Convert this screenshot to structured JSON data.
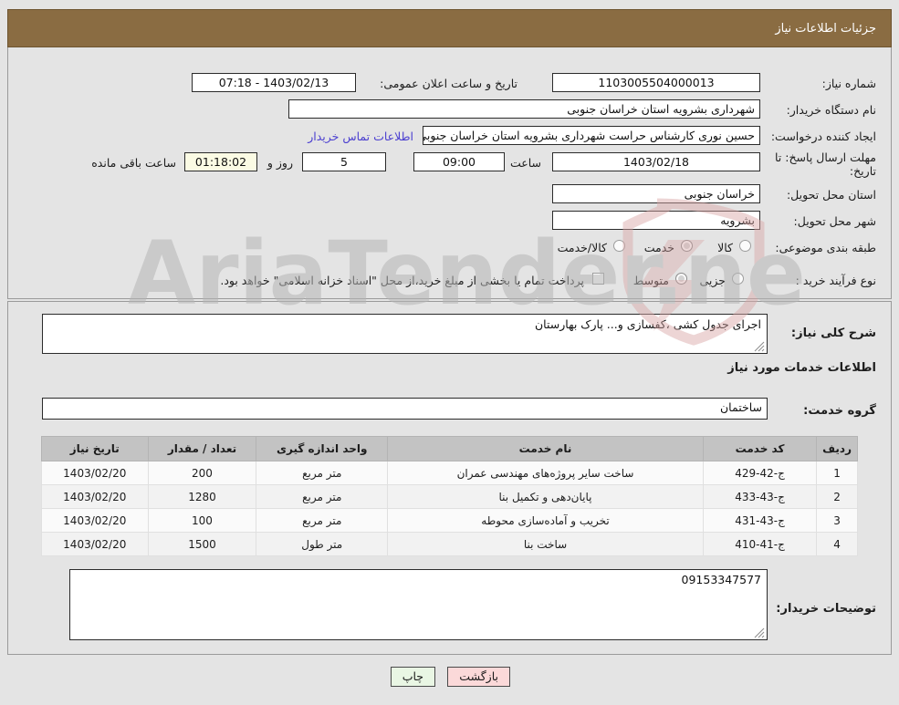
{
  "header": {
    "title": "جزئیات اطلاعات نیاز"
  },
  "top_form": {
    "need_number_label": "شماره نیاز:",
    "need_number_value": "1103005504000013",
    "public_announce_label": "تاریخ و ساعت اعلان عمومی:",
    "public_announce_value": "1403/02/13 - 07:18",
    "buyer_org_label": "نام دستگاه خریدار:",
    "buyer_org_value": "شهرداری بشرویه استان خراسان جنوبی",
    "requester_label": "ایجاد کننده درخواست:",
    "requester_value": "حسین نوری کارشناس حراست شهرداری بشرویه استان خراسان جنوبی",
    "contact_link": "اطلاعات تماس خریدار",
    "deadline_label": "مهلت ارسال پاسخ: تا تاریخ:",
    "deadline_date": "1403/02/18",
    "hour_label": "ساعت",
    "hour_value": "09:00",
    "days_value": "5",
    "days_suffix": "روز و",
    "countdown_value": "01:18:02",
    "countdown_suffix": "ساعت باقی مانده",
    "province_label": "استان محل تحویل:",
    "province_value": "خراسان جنوبی",
    "city_label": "شهر محل تحویل:",
    "city_value": "بشرویه",
    "category_label": "طبقه بندی موضوعی:",
    "category_options": [
      "کالا",
      "خدمت",
      "کالا/خدمت"
    ],
    "category_selected": "خدمت",
    "process_label": "نوع فرآیند خرید :",
    "process_options": [
      "جزیی",
      "متوسط"
    ],
    "process_selected": "متوسط",
    "treasury_note": "پرداخت تمام یا بخشی از مبلغ خرید،از محل \"اسناد خزانه اسلامی\" خواهد بود."
  },
  "bottom_form": {
    "summary_label": "شرح کلی نیاز:",
    "summary_value": "اجرای جدول کشی ،کفسازی و... پارک بهارستان",
    "services_section_title": "اطلاعات خدمات مورد نیاز",
    "service_group_label": "گروه خدمت:",
    "service_group_value": "ساختمان",
    "buyer_notes_label": "توضیحات خریدار:",
    "buyer_notes_value": "09153347577"
  },
  "table": {
    "headers": [
      "ردیف",
      "کد خدمت",
      "نام خدمت",
      "واحد اندازه گیری",
      "تعداد / مقدار",
      "تاریخ نیاز"
    ],
    "rows": [
      {
        "radif": "1",
        "code": "ج-42-429",
        "name": "ساخت سایر پروژه‌های مهندسی عمران",
        "unit": "متر مربع",
        "qty": "200",
        "date": "1403/02/20"
      },
      {
        "radif": "2",
        "code": "ج-43-433",
        "name": "پایان‌دهی و تکمیل بنا",
        "unit": "متر مربع",
        "qty": "1280",
        "date": "1403/02/20"
      },
      {
        "radif": "3",
        "code": "ج-43-431",
        "name": "تخریب و آماده‌سازی محوطه",
        "unit": "متر مربع",
        "qty": "100",
        "date": "1403/02/20"
      },
      {
        "radif": "4",
        "code": "ج-41-410",
        "name": "ساخت بنا",
        "unit": "متر طول",
        "qty": "1500",
        "date": "1403/02/20"
      }
    ]
  },
  "footer": {
    "print_label": "چاپ",
    "back_label": "بازگشت"
  },
  "watermark": {
    "text": "AriaTender.net",
    "shield_color": "#d8a5a5",
    "text_color": "#b6b6b6"
  },
  "colors": {
    "header_bar": "#8a6c42",
    "page_bg": "#e4e4e4",
    "table_header": "#c3c3c3",
    "link": "#4b3fd0",
    "countdown_bg": "#fbfbe4",
    "print_btn": "#e9f6e4",
    "back_btn": "#fbd9d9"
  }
}
